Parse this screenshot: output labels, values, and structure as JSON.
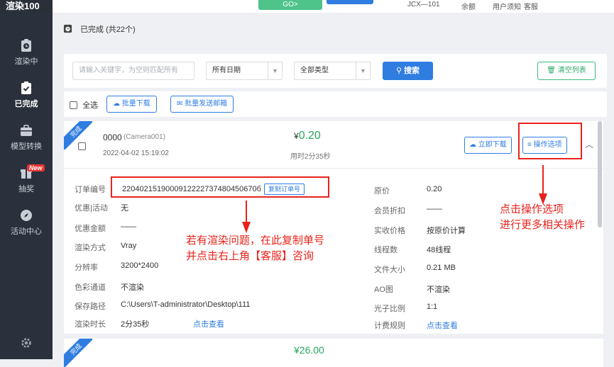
{
  "app": {
    "logo": "渲染100"
  },
  "sidebar": {
    "items": [
      {
        "label": "渲染中"
      },
      {
        "label": "已完成"
      },
      {
        "label": "模型转换"
      },
      {
        "label": "抽奖",
        "badge": "New"
      },
      {
        "label": "活动中心"
      }
    ]
  },
  "topbar": {
    "go_label": "GO>",
    "account": "JCX—101",
    "balance_label": "余额",
    "notice": "用户须知",
    "service": "客服"
  },
  "page": {
    "title": "已完成 (共22个)"
  },
  "filter": {
    "search_placeholder": "请输入关键字，为空则匹配所有",
    "date_select": "所有日期",
    "type_select": "全部类型",
    "search_button": "搜索",
    "clear_button": "清空列表"
  },
  "bulk": {
    "select_all": "全选",
    "batch_download": "批量下载",
    "batch_email": "批量发送邮箱"
  },
  "order": {
    "ribbon": "完成",
    "name": "0000",
    "camera": "(Camera001)",
    "datetime": "2022-04-02 15:19:02",
    "price_symbol": "¥",
    "price": "0.20",
    "duration": "用时2分35秒",
    "download_button": "立即下载",
    "options_button": "操作选项",
    "fields_left": [
      {
        "label": "订单编号",
        "value": "2204021519000912222737480450670б"
      },
      {
        "label": "优惠|活动",
        "value": "无"
      },
      {
        "label": "优惠金额",
        "value": "——"
      },
      {
        "label": "渲染方式",
        "value": "Vray"
      },
      {
        "label": "分辨率",
        "value": "3200*2400"
      },
      {
        "label": "色彩通道",
        "value": "不渲染"
      },
      {
        "label": "保存路径",
        "value": "C:\\Users\\T-administrator\\Desktop\\111"
      },
      {
        "label": "渲染时长",
        "value": "2分35秒"
      }
    ],
    "copy_order": "复制订单号",
    "view_link": "点击查看",
    "fields_right": [
      {
        "label": "原价",
        "value": "0.20"
      },
      {
        "label": "会员折扣",
        "value": "——"
      },
      {
        "label": "实收价格",
        "value": "按原价计算"
      },
      {
        "label": "线程数",
        "value": "48线程"
      },
      {
        "label": "文件大小",
        "value": "0.21 MB"
      },
      {
        "label": "AO图",
        "value": "不渲染"
      },
      {
        "label": "光子比例",
        "value": "1:1"
      },
      {
        "label": "计费规则",
        "value": "点击查看"
      }
    ]
  },
  "annotations": {
    "left_line1": "若有渲染问题，在此复制单号",
    "left_line2": "并点击右上角【客服】咨询",
    "right_line1": "点击操作选项",
    "right_line2": "进行更多相关操作"
  },
  "next_card": {
    "price": "¥26.00"
  },
  "colors": {
    "accent": "#2f7de1",
    "success": "#28a65f",
    "annotation": "#e8231b",
    "sidebar": "#2b313c"
  }
}
